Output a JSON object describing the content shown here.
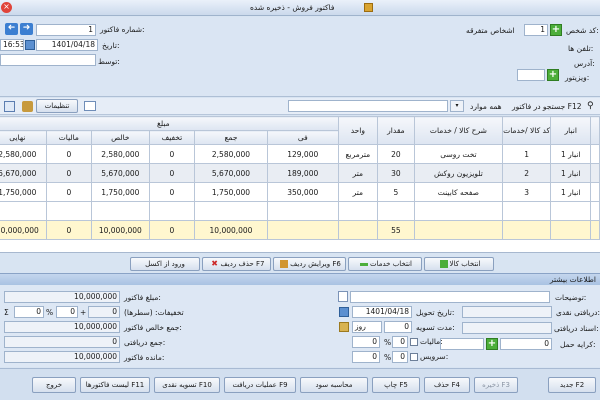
{
  "window": {
    "title": "فاکتور فروش - ذخیره شده"
  },
  "header": {
    "customer_code_label": "کد شخص:",
    "customer_code": "1",
    "customer_name": "اشخاص متفرقه",
    "phones_label": "تلفن ها:",
    "address_label": "آدرس:",
    "visitor_label": "ویزیتور:",
    "invoice_no_label": "شماره فاکتور:",
    "invoice_no": "1",
    "date_label": "تاریخ:",
    "date": "1401/04/18",
    "time": "16:53",
    "by_label": "توسط:"
  },
  "toolbar": {
    "settings_label": "تنظیمات",
    "search_label": "جستجو در فاکتور F12",
    "search_scope": "همه موارد"
  },
  "grid": {
    "group_header": "مبلغ",
    "columns": [
      "انبار",
      "کد کالا /خدمات",
      "شرح کالا / خدمات",
      "مقدار",
      "واحد",
      "فی",
      "جمع",
      "تخفیف",
      "خالص",
      "مالیات",
      "نهایی"
    ],
    "rows": [
      {
        "warehouse": "انبار 1",
        "code": "1",
        "desc": "تخت روسی",
        "qty": "20",
        "unit": "مترمربع",
        "price": "129,000",
        "sum": "2,580,000",
        "discount": "0",
        "net": "2,580,000",
        "tax": "0",
        "final": "2,580,000"
      },
      {
        "warehouse": "انبار 1",
        "code": "2",
        "desc": "تلویزیون روکش",
        "qty": "30",
        "unit": "متر",
        "price": "189,000",
        "sum": "5,670,000",
        "discount": "0",
        "net": "5,670,000",
        "tax": "0",
        "final": "5,670,000"
      },
      {
        "warehouse": "انبار 1",
        "code": "3",
        "desc": "صفحه کابینت",
        "qty": "5",
        "unit": "متر",
        "price": "350,000",
        "sum": "1,750,000",
        "discount": "0",
        "net": "1,750,000",
        "tax": "0",
        "final": "1,750,000"
      }
    ],
    "totals": {
      "qty": "55",
      "sum": "10,000,000",
      "discount": "0",
      "net": "10,000,000",
      "tax": "0",
      "final": "10,000,000"
    }
  },
  "row_actions": {
    "select_goods": "انتخاب کالا",
    "select_services": "انتخاب خدمات",
    "edit_row": "ویرایش ردیف F6",
    "delete_row": "حذف ردیف F7",
    "import_excel": "ورود از اکسل"
  },
  "more_info": {
    "title": "اطلاعات بیشتر",
    "notes_label": "توضیحات:",
    "cash_received_label": "دریافتی نقدی:",
    "receive_date_label": "تاریخ تحویل:",
    "receive_date": "1401/04/18",
    "settle_period_label": "مدت تسویه:",
    "settle_days": "0",
    "settle_unit": "روز",
    "cheques_label": "اسناد دریافتی:",
    "tax_label": "مالیات:",
    "tax_pct": "0",
    "tax_amount": "0",
    "freight_label": "کرایه حمل:",
    "freight": "0",
    "service_label": "سرویس:",
    "service_pct": "0",
    "service_amount": "0",
    "invoice_amount_label": "مبلغ فاکتور:",
    "invoice_amount": "10,000,000",
    "discounts_label": "تخفیفات: (سطرها)",
    "discount_rows": "0",
    "discount_pct": "0",
    "discount_extra": "0",
    "net_total_label": "جمع خالص فاکتور:",
    "net_total": "10,000,000",
    "received_total_label": "جمع دریافتی:",
    "received_total": "0",
    "remaining_label": "مانده فاکتور:",
    "remaining": "10,000,000"
  },
  "footer": {
    "new": "جدید F2",
    "save": "ذخیره F3",
    "delete": "حذف F4",
    "print": "چاپ F5",
    "profit": "محاسبه سود",
    "receipts": "عملیات دریافت F9",
    "cash_settle": "تسویه نقدی F10",
    "invoice_list": "لیست فاکتورها F11",
    "exit": "خروج"
  }
}
